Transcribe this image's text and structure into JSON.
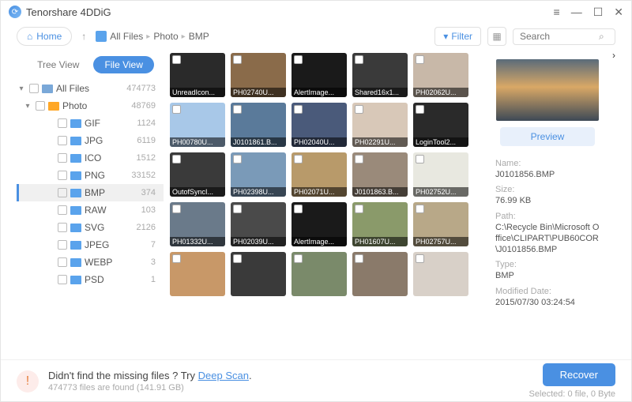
{
  "app": {
    "title": "Tenorshare 4DDiG"
  },
  "toolbar": {
    "home": "Home",
    "breadcrumbs": [
      "All Files",
      "Photo",
      "BMP"
    ],
    "filter": "Filter",
    "search_placeholder": "Search"
  },
  "sidebar": {
    "tabs": {
      "tree": "Tree View",
      "file": "File View"
    },
    "root": {
      "label": "All Files",
      "count": "474773"
    },
    "photo": {
      "label": "Photo",
      "count": "48769"
    },
    "children": [
      {
        "label": "GIF",
        "count": "1124"
      },
      {
        "label": "JPG",
        "count": "6119"
      },
      {
        "label": "ICO",
        "count": "1512"
      },
      {
        "label": "PNG",
        "count": "33152"
      },
      {
        "label": "BMP",
        "count": "374",
        "selected": true
      },
      {
        "label": "RAW",
        "count": "103"
      },
      {
        "label": "SVG",
        "count": "2126"
      },
      {
        "label": "JPEG",
        "count": "7"
      },
      {
        "label": "WEBP",
        "count": "3"
      },
      {
        "label": "PSD",
        "count": "1"
      }
    ]
  },
  "thumbs": [
    {
      "name": "UnreadIcon...",
      "bg": "#2a2a2a"
    },
    {
      "name": "PH02740U...",
      "bg": "#8a6b4a"
    },
    {
      "name": "AlertImage...",
      "bg": "#1a1a1a"
    },
    {
      "name": "Shared16x1...",
      "bg": "#3a3a3a"
    },
    {
      "name": "PH02062U...",
      "bg": "#c8b8a8"
    },
    {
      "name": "PH00780U...",
      "bg": "#a8c8e8"
    },
    {
      "name": "J0101861.B...",
      "bg": "#5a7a9a"
    },
    {
      "name": "PH02040U...",
      "bg": "#4a5a7a"
    },
    {
      "name": "PH02291U...",
      "bg": "#d8c8b8"
    },
    {
      "name": "LoginTool2...",
      "bg": "#2a2a2a"
    },
    {
      "name": "OutofSyncI...",
      "bg": "#3a3a3a"
    },
    {
      "name": "PH02398U...",
      "bg": "#7a9ab8"
    },
    {
      "name": "PH02071U...",
      "bg": "#b89a6a"
    },
    {
      "name": "J0101863.B...",
      "bg": "#9a8a7a"
    },
    {
      "name": "PH02752U...",
      "bg": "#e8e8e0"
    },
    {
      "name": "PH01332U...",
      "bg": "#6a7a8a"
    },
    {
      "name": "PH02039U...",
      "bg": "#4a4a4a"
    },
    {
      "name": "AlertImage...",
      "bg": "#1a1a1a"
    },
    {
      "name": "PH01607U...",
      "bg": "#8a9a6a"
    },
    {
      "name": "PH02757U...",
      "bg": "#b8a888"
    },
    {
      "name": "",
      "bg": "#c89868"
    },
    {
      "name": "",
      "bg": "#3a3a3a"
    },
    {
      "name": "",
      "bg": "#7a8a6a"
    },
    {
      "name": "",
      "bg": "#8a7a6a"
    },
    {
      "name": "",
      "bg": "#d8d0c8"
    }
  ],
  "preview": {
    "button": "Preview",
    "name_label": "Name:",
    "name": "J0101856.BMP",
    "size_label": "Size:",
    "size": "76.99 KB",
    "path_label": "Path:",
    "path": "C:\\Recycle Bin\\Microsoft Office\\CLIPART\\PUB60COR\\J0101856.BMP",
    "type_label": "Type:",
    "type": "BMP",
    "date_label": "Modified Date:",
    "date": "2015/07/30 03:24:54"
  },
  "footer": {
    "line1a": "Didn't find the missing files ? Try ",
    "link": "Deep Scan",
    "line1b": ".",
    "line2": "474773 files are found (141.91 GB)",
    "recover": "Recover",
    "selected": "Selected: 0 file, 0 Byte"
  }
}
